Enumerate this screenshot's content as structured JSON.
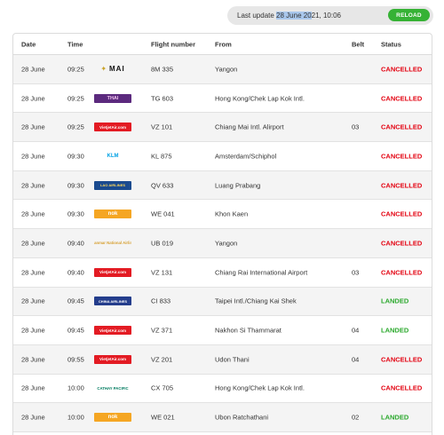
{
  "topbar": {
    "last_update_prefix": "Last update ",
    "last_update_date": "28 June 20",
    "last_update_suffix": "21, 10:06",
    "reload_label": "RELOAD"
  },
  "table": {
    "headers": {
      "date": "Date",
      "time": "Time",
      "flight": "Flight number",
      "from": "From",
      "belt": "Belt",
      "status": "Status"
    },
    "rows": [
      {
        "date": "28 June",
        "time": "09:25",
        "logo_text": "MAI",
        "logo_icon": "myanmar-airways-logo",
        "flight": "8M 335",
        "from": "Yangon",
        "belt": "",
        "status": "CANCELLED"
      },
      {
        "date": "28 June",
        "time": "09:25",
        "logo_text": "THAI",
        "logo_icon": "thai-airways-logo",
        "flight": "TG 603",
        "from": "Hong Kong/Chek Lap Kok Intl.",
        "belt": "",
        "status": "CANCELLED"
      },
      {
        "date": "28 June",
        "time": "09:25",
        "logo_text": "VietjetAir.com",
        "logo_icon": "vietjet-logo",
        "flight": "VZ 101",
        "from": "Chiang Mai Intl. Alirport",
        "belt": "03",
        "status": "CANCELLED"
      },
      {
        "date": "28 June",
        "time": "09:30",
        "logo_text": "KLM",
        "logo_icon": "klm-logo",
        "flight": "KL 875",
        "from": "Amsterdam/Schiphol",
        "belt": "",
        "status": "CANCELLED"
      },
      {
        "date": "28 June",
        "time": "09:30",
        "logo_text": "LAO AIRLINES",
        "logo_icon": "lao-skyway-logo",
        "flight": "QV 633",
        "from": "Luang Prabang",
        "belt": "",
        "status": "CANCELLED"
      },
      {
        "date": "28 June",
        "time": "09:30",
        "logo_text": "nok",
        "logo_icon": "nok-air-logo",
        "flight": "WE 041",
        "from": "Khon Kaen",
        "belt": "",
        "status": "CANCELLED"
      },
      {
        "date": "28 June",
        "time": "09:40",
        "logo_text": "Myanmar National Airlines",
        "logo_icon": "myanmar-national-logo",
        "flight": "UB 019",
        "from": "Yangon",
        "belt": "",
        "status": "CANCELLED"
      },
      {
        "date": "28 June",
        "time": "09:40",
        "logo_text": "VietjetAir.com",
        "logo_icon": "vietjet-logo",
        "flight": "VZ 131",
        "from": "Chiang Rai International Airport",
        "belt": "03",
        "status": "CANCELLED"
      },
      {
        "date": "28 June",
        "time": "09:45",
        "logo_text": "CHINA AIRLINES",
        "logo_icon": "china-airlines-logo",
        "flight": "CI 833",
        "from": "Taipei Intl./Chiang Kai Shek",
        "belt": "",
        "status": "LANDED"
      },
      {
        "date": "28 June",
        "time": "09:45",
        "logo_text": "VietjetAir.com",
        "logo_icon": "vietjet-logo",
        "flight": "VZ 371",
        "from": "Nakhon Si Thammarat",
        "belt": "04",
        "status": "LANDED"
      },
      {
        "date": "28 June",
        "time": "09:55",
        "logo_text": "VietjetAir.com",
        "logo_icon": "vietjet-logo",
        "flight": "VZ 201",
        "from": "Udon Thani",
        "belt": "04",
        "status": "CANCELLED"
      },
      {
        "date": "28 June",
        "time": "10:00",
        "logo_text": "CATHAY PACIFIC",
        "logo_icon": "cathay-pacific-logo",
        "flight": "CX 705",
        "from": "Hong Kong/Chek Lap Kok Intl.",
        "belt": "",
        "status": "CANCELLED"
      },
      {
        "date": "28 June",
        "time": "10:00",
        "logo_text": "nok",
        "logo_icon": "nok-air-logo",
        "flight": "WE 021",
        "from": "Ubon Ratchathani",
        "belt": "02",
        "status": "LANDED"
      }
    ]
  },
  "colors": {
    "cancelled": "#e3000f",
    "landed": "#29a82b",
    "reload": "#36b235"
  }
}
